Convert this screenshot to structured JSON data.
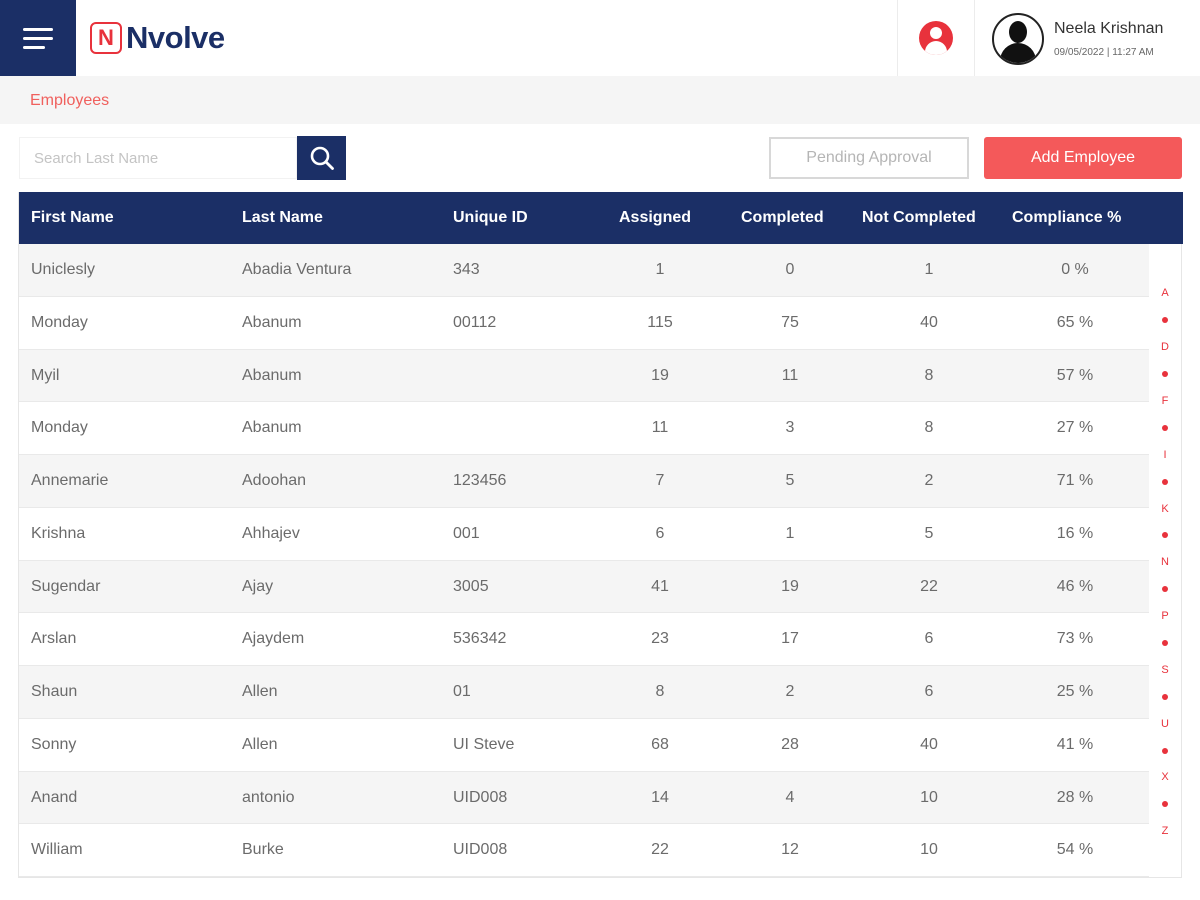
{
  "brand": {
    "logo_letter": "N",
    "logo_text": "Nvolve",
    "accent": "#e8323c",
    "primary": "#1b2f66"
  },
  "header": {
    "menu_icon": "hamburger-icon",
    "user_icon": "user-circle-icon",
    "user_name": "Neela Krishnan",
    "timestamp": "09/05/2022 | 11:27 AM"
  },
  "breadcrumb": {
    "label": "Employees"
  },
  "search": {
    "placeholder": "Search Last Name",
    "value": "",
    "icon": "search-icon"
  },
  "actions": {
    "pending_label": "Pending Approval",
    "add_label": "Add Employee"
  },
  "table": {
    "headers": [
      "First Name",
      "Last Name",
      "Unique ID",
      "Assigned",
      "Completed",
      "Not Completed",
      "Compliance %"
    ],
    "rows": [
      [
        "Uniclesly",
        "Abadia Ventura",
        "343",
        "1",
        "0",
        "1",
        "0 %"
      ],
      [
        "Monday",
        "Abanum",
        "00112",
        "115",
        "75",
        "40",
        "65 %"
      ],
      [
        "Myil",
        "Abanum",
        "",
        "19",
        "11",
        "8",
        "57 %"
      ],
      [
        "Monday",
        "Abanum",
        "",
        "11",
        "3",
        "8",
        "27 %"
      ],
      [
        "Annemarie",
        "Adoohan",
        "123456",
        "7",
        "5",
        "2",
        "71 %"
      ],
      [
        "Krishna",
        "Ahhajev",
        "001",
        "6",
        "1",
        "5",
        "16 %"
      ],
      [
        "Sugendar",
        "Ajay",
        "3005",
        "41",
        "19",
        "22",
        "46 %"
      ],
      [
        "Arslan",
        "Ajaydem",
        "536342",
        "23",
        "17",
        "6",
        "73 %"
      ],
      [
        "Shaun",
        "Allen",
        "01",
        "8",
        "2",
        "6",
        "25 %"
      ],
      [
        "Sonny",
        "Allen",
        "UI Steve",
        "68",
        "28",
        "40",
        "41 %"
      ],
      [
        "Anand",
        "antonio",
        "UID008",
        "14",
        "4",
        "10",
        "28 %"
      ],
      [
        "William",
        "Burke",
        "UID008",
        "22",
        "12",
        "10",
        "54 %"
      ]
    ]
  },
  "alphabet_index": [
    "A",
    "•",
    "D",
    "•",
    "F",
    "•",
    "I",
    "•",
    "K",
    "•",
    "N",
    "•",
    "P",
    "•",
    "S",
    "•",
    "U",
    "•",
    "X",
    "•",
    "Z"
  ]
}
